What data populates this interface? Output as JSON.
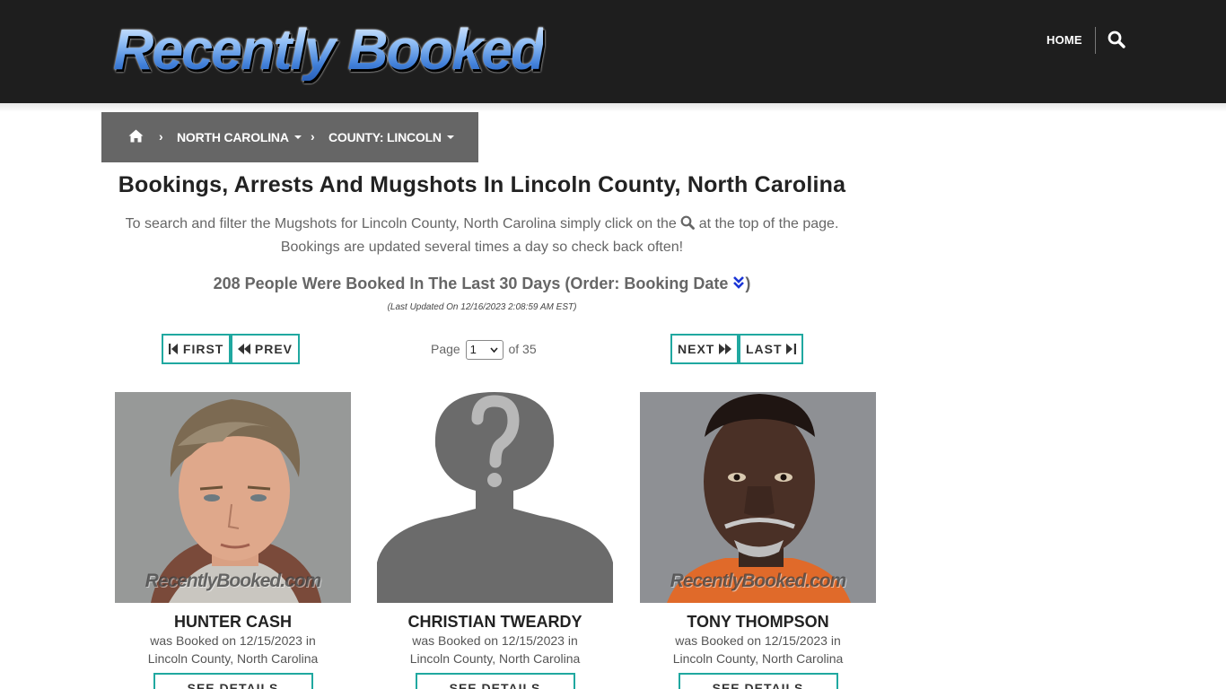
{
  "header": {
    "logo_text": "Recently Booked",
    "nav_home": "HOME"
  },
  "breadcrumb": {
    "separator": "›",
    "items": [
      {
        "label": "NORTH CAROLINA"
      },
      {
        "label": "COUNTY: LINCOLN"
      }
    ]
  },
  "page": {
    "title": "Bookings, Arrests And Mugshots In Lincoln County, North Carolina",
    "intro_before": "To search and filter the Mugshots for Lincoln County, North Carolina simply click on the",
    "intro_after": "at the top of the page.",
    "intro_line2": "Bookings are updated several times a day so check back often!",
    "count_text": "208 People Were Booked In The Last 30 Days (Order: Booking Date",
    "count_close": ")",
    "last_updated": "(Last Updated On 12/16/2023 2:08:59 AM EST)"
  },
  "pagination": {
    "first": "FIRST",
    "prev": "PREV",
    "next": "NEXT",
    "last": "LAST",
    "page_label": "Page",
    "current_page": "1",
    "of_label": "of 35"
  },
  "cards": [
    {
      "name": "HUNTER CASH",
      "booked": "was Booked on 12/15/2023 in",
      "location": "Lincoln County, North Carolina",
      "button": "SEE DETAILS",
      "watermark": "RecentlyBooked.com"
    },
    {
      "name": "CHRISTIAN TWEARDY",
      "booked": "was Booked on 12/15/2023 in",
      "location": "Lincoln County, North Carolina",
      "button": "SEE DETAILS",
      "watermark": ""
    },
    {
      "name": "TONY THOMPSON",
      "booked": "was Booked on 12/15/2023 in",
      "location": "Lincoln County, North Carolina",
      "button": "SEE DETAILS",
      "watermark": "RecentlyBooked.com"
    }
  ],
  "colors": {
    "header_bg": "#1e1e1e",
    "breadcrumb_bg": "#666666",
    "button_border": "#20a8a0",
    "order_toggle": "#1a35d6"
  }
}
